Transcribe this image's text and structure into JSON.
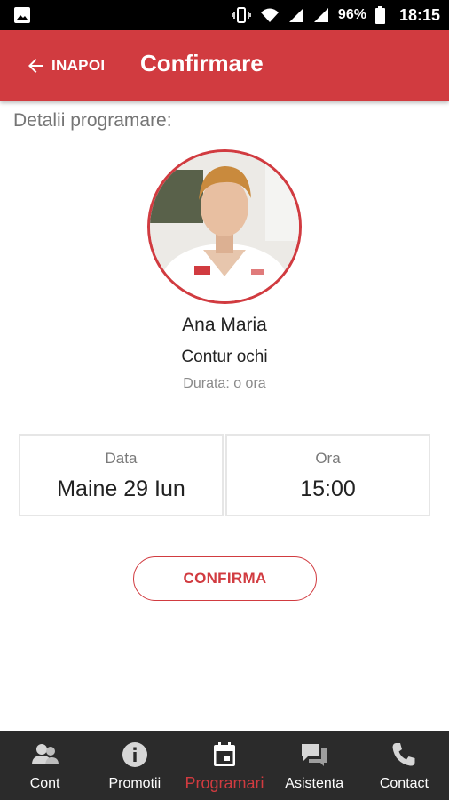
{
  "status_bar": {
    "battery": "96%",
    "time": "18:15"
  },
  "header": {
    "back_label": "INAPOI",
    "title": "Confirmare"
  },
  "section_title": "Detalii programare:",
  "specialist": {
    "name": "Ana Maria",
    "service": "Contur ochi",
    "duration": "Durata: o ora"
  },
  "appointment": {
    "date_caption": "Data",
    "date_value": "Maine 29 Iun",
    "time_caption": "Ora",
    "time_value": "15:00"
  },
  "confirm_label": "CONFIRMA",
  "bottom_nav": {
    "items": [
      {
        "label": "Cont",
        "icon": "account-icon"
      },
      {
        "label": "Promotii",
        "icon": "info-icon"
      },
      {
        "label": "Programari",
        "icon": "calendar-icon",
        "active": true
      },
      {
        "label": "Asistenta",
        "icon": "chat-icon"
      },
      {
        "label": "Contact",
        "icon": "phone-icon"
      }
    ]
  },
  "colors": {
    "accent": "#d13b40",
    "nav_background": "#2b2b2b",
    "status_bar": "#000000"
  }
}
